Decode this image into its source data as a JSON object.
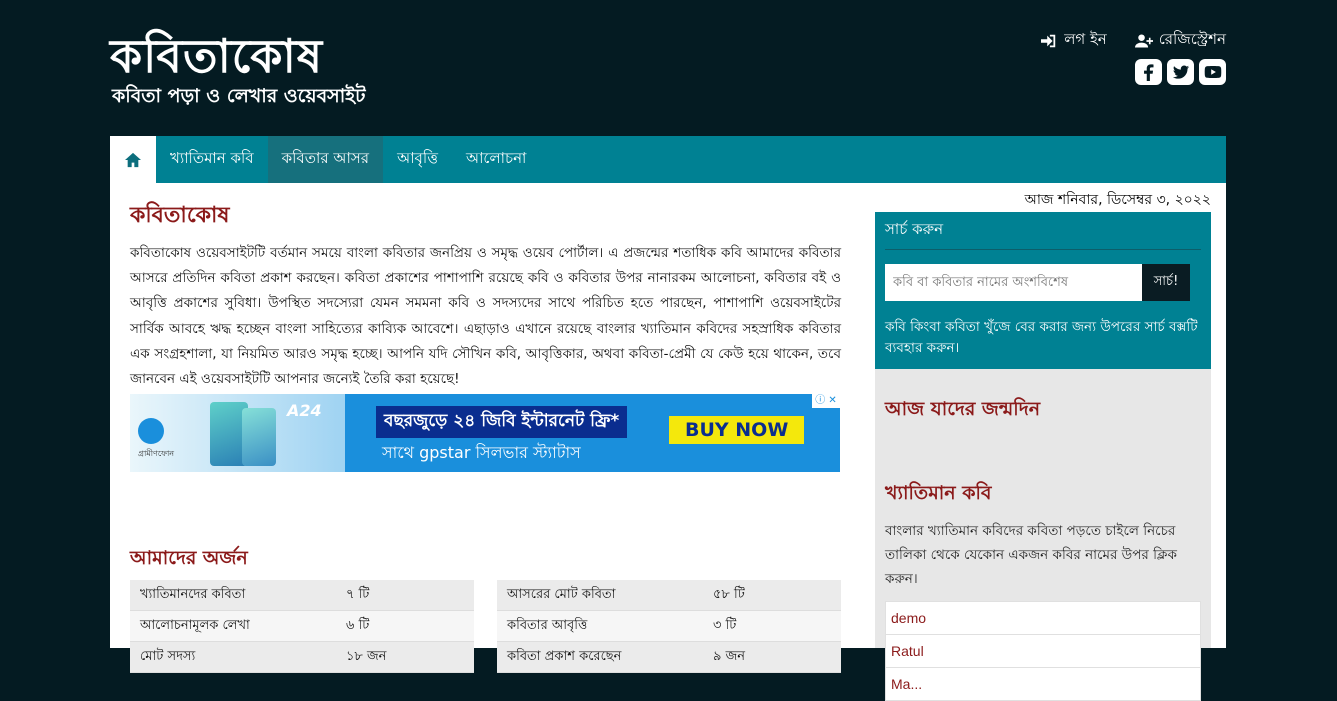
{
  "logo": {
    "title": "কবিতাকোষ",
    "subtitle": "কবিতা পড়া ও লেখার ওয়েবসাইট"
  },
  "auth": {
    "login": "লগ ইন",
    "register": "রেজিস্ট্রেশন"
  },
  "social": [
    {
      "icon": "facebook-icon"
    },
    {
      "icon": "twitter-icon"
    },
    {
      "icon": "youtube-icon"
    }
  ],
  "nav": {
    "items": [
      {
        "label": "খ্যাতিমান কবি"
      },
      {
        "label": "কবিতার আসর"
      },
      {
        "label": "আবৃত্তি"
      },
      {
        "label": "আলোচনা"
      }
    ]
  },
  "date": "আজ শনিবার, ডিসেম্বর ৩, ২০২২",
  "main": {
    "title": "কবিতাকোষ",
    "intro": "কবিতাকোষ ওয়েবসাইটটি বর্তমান সময়ে বাংলা কবিতার জনপ্রিয় ও সমৃদ্ধ ওয়েব পোর্টাল। এ প্রজন্মের শতাধিক কবি আমাদের কবিতার আসরে প্রতিদিন কবিতা প্রকাশ করছেন। কবিতা প্রকাশের পাশাপাশি রয়েছে কবি ও কবিতার উপর নানারকম আলোচনা, কবিতার বই ও আবৃত্তি প্রকাশের সুবিধা। উপস্থিত সদস্যেরা যেমন সমমনা কবি ও সদস্যদের সাথে পরিচিত হতে পারছেন, পাশাপাশি ওয়েবসাইটের সার্বিক আবহে ঋদ্ধ হচ্ছেন বাংলা সাহিত্যের কাব্যিক আবেশে। এছাড়াও এখানে রয়েছে বাংলার খ্যাতিমান কবিদের সহস্রাধিক কবিতার এক সংগ্রহশালা, যা নিয়মিত আরও সমৃদ্ধ হচ্ছে। আপনি যদি সৌখিন কবি, আবৃত্তিকার, অথবা কবিতা-প্রেমী যে কেউ হয়ে থাকেন, তবে জানবেন এই ওয়েবসাইটটি আপনার জন্যেই তৈরি করা হয়েছে!",
    "ad": {
      "model": "A24",
      "brand": "গ্রামীণফোন",
      "headline": "বছরজুড়ে ২৪ জিবি ইন্টারনেট ফ্রি*",
      "subline": "সাথে gpstar সিলভার স্ট্যাটাস",
      "cta": "BUY NOW",
      "close": "ⓘ ✕"
    },
    "achievements_title": "আমাদের অর্জন",
    "stats_left": [
      {
        "label": "খ্যাতিমানদের কবিতা",
        "value": "৭ টি"
      },
      {
        "label": "আলোচনামূলক লেখা",
        "value": "৬ টি"
      },
      {
        "label": "মোট সদস্য",
        "value": "১৮ জন"
      }
    ],
    "stats_right": [
      {
        "label": "আসরের মোট কবিতা",
        "value": "৫৮ টি"
      },
      {
        "label": "কবিতার আবৃত্তি",
        "value": "৩ টি"
      },
      {
        "label": "কবিতা প্রকাশ করেছেন",
        "value": "৯ জন"
      }
    ]
  },
  "sidebar": {
    "search_title": "সার্চ করুন",
    "search_placeholder": "কবি বা কবিতার নামের অংশবিশেষ",
    "search_button": "সার্চ!",
    "search_help": "কবি কিংবা কবিতা খুঁজে বের করার জন্য উপরের সার্চ বক্সটি ব্যবহার করুন।",
    "birthday_title": "আজ যাদের জন্মদিন",
    "famous_title": "খ্যাতিমান কবি",
    "famous_text": "বাংলার খ্যাতিমান কবিদের কবিতা পড়তে চাইলে নিচের তালিকা থেকে যেকোন একজন কবির নামের উপর ক্লিক করুন।",
    "poets": [
      "demo",
      "Ratul",
      "Ma..."
    ]
  }
}
